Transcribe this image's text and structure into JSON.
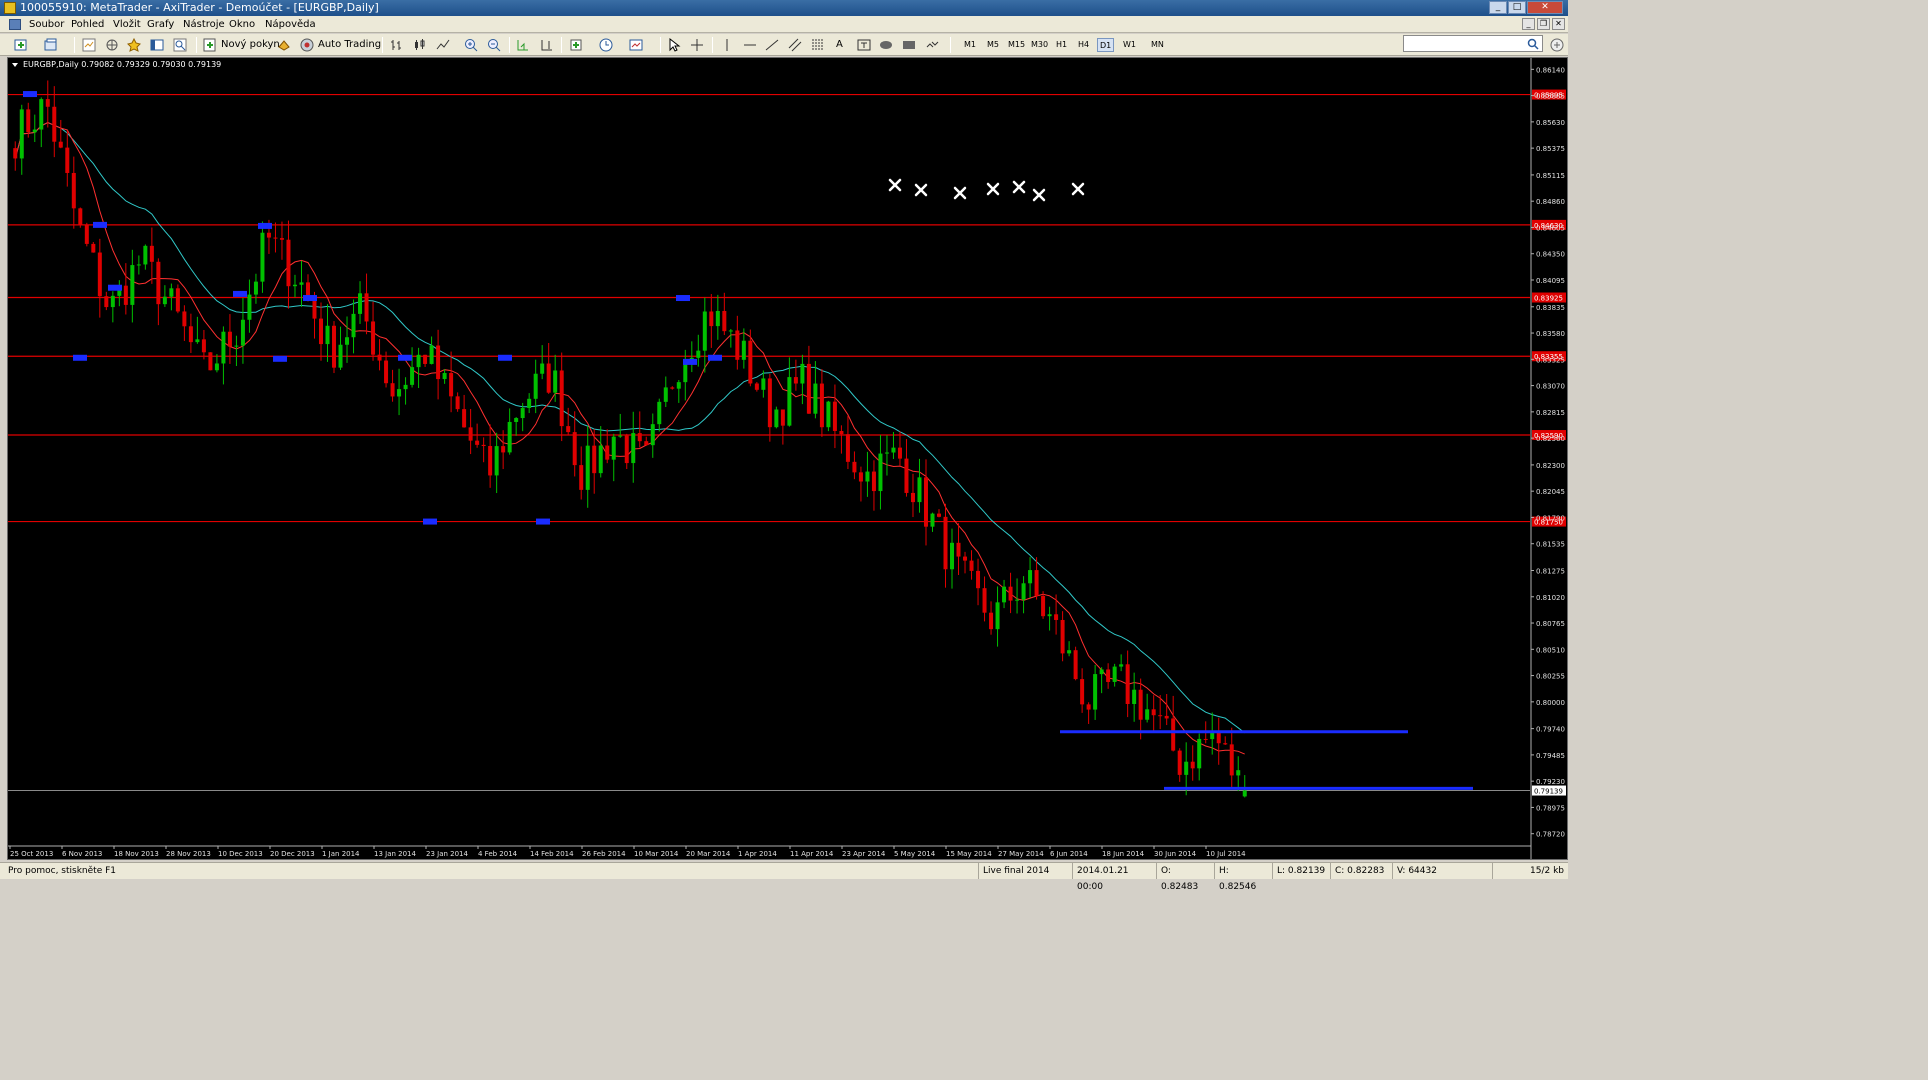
{
  "window": {
    "title": "100055910: MetaTrader - AxiTrader - Demoúčet - [EURGBP,Daily]"
  },
  "menu": [
    "Soubor",
    "Pohled",
    "Vložit",
    "Grafy",
    "Nástroje",
    "Okno",
    "Nápověda"
  ],
  "toolbar": {
    "new_order": "Nový pokyn",
    "auto_trading": "Auto Trading",
    "timeframes": [
      "M1",
      "M5",
      "M15",
      "M30",
      "H1",
      "H4",
      "D1",
      "W1",
      "MN"
    ],
    "active_timeframe": "D1",
    "draw_text_tool": "A"
  },
  "chart": {
    "header": "EURGBP,Daily  0.79082 0.79329 0.79030 0.79139",
    "current_price": "0.79139",
    "bull_color": "#00c000",
    "bear_color": "#e00000",
    "ma_fast_color": "#ff3030",
    "ma_slow_color": "#30c8c8"
  },
  "chart_data": {
    "type": "candlestick",
    "symbol": "EURGBP",
    "timeframe": "Daily",
    "ohlc_last": {
      "open": 0.79082,
      "high": 0.79329,
      "low": 0.7903,
      "close": 0.79139
    },
    "x_labels": [
      "25 Oct 2013",
      "6 Nov 2013",
      "18 Nov 2013",
      "28 Nov 2013",
      "10 Dec 2013",
      "20 Dec 2013",
      "1 Jan 2014",
      "13 Jan 2014",
      "23 Jan 2014",
      "4 Feb 2014",
      "14 Feb 2014",
      "26 Feb 2014",
      "10 Mar 2014",
      "20 Mar 2014",
      "1 Apr 2014",
      "11 Apr 2014",
      "23 Apr 2014",
      "5 May 2014",
      "15 May 2014",
      "27 May 2014",
      "6 Jun 2014",
      "18 Jun 2014",
      "30 Jun 2014",
      "10 Jul 2014"
    ],
    "y_ticks": [
      "0.86140",
      "0.85885",
      "0.85630",
      "0.85375",
      "0.85115",
      "0.84860",
      "0.84605",
      "0.84350",
      "0.84095",
      "0.83835",
      "0.83580",
      "0.83325",
      "0.83070",
      "0.82815",
      "0.82560",
      "0.82300",
      "0.82045",
      "0.81790",
      "0.81535",
      "0.81275",
      "0.81020",
      "0.80765",
      "0.80510",
      "0.80255",
      "0.80000",
      "0.79740",
      "0.79485",
      "0.79230",
      "0.78975",
      "0.78720"
    ],
    "y_range": [
      0.7862,
      0.8625
    ],
    "horizontal_lines_red": [
      "0.85895",
      "0.84630",
      "0.83925",
      "0.83355",
      "0.82590",
      "0.81750"
    ],
    "horizontal_lines_blue": [
      {
        "price": 0.7971,
        "from": "6 Jun 2014",
        "to": "end"
      },
      {
        "price": 0.7916,
        "from": "30 Jun 2014",
        "to": "end"
      }
    ],
    "x_markers_count": 7,
    "close_waypoints": [
      0.855,
      0.858,
      0.846,
      0.838,
      0.843,
      0.838,
      0.832,
      0.836,
      0.845,
      0.841,
      0.834,
      0.838,
      0.83,
      0.834,
      0.828,
      0.822,
      0.829,
      0.832,
      0.822,
      0.826,
      0.823,
      0.833,
      0.838,
      0.834,
      0.828,
      0.831,
      0.826,
      0.822,
      0.824,
      0.818,
      0.812,
      0.808,
      0.812,
      0.807,
      0.8,
      0.802,
      0.799,
      0.794,
      0.797,
      0.791
    ]
  },
  "status": {
    "help": "Pro pomoc, stiskněte F1",
    "profile": "Live final 2014",
    "datetime": "2014.01.21 00:00",
    "open": "O: 0.82483",
    "high": "H: 0.82546",
    "low": "L: 0.82139",
    "close": "C: 0.82283",
    "volume": "V: 64432",
    "traffic": "15/2 kb"
  }
}
